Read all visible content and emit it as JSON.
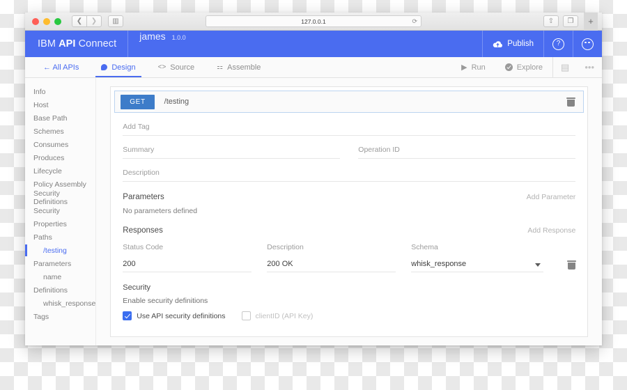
{
  "browser": {
    "url": "127.0.0.1",
    "back_icon": "chevron-left-icon",
    "forward_icon": "chevron-right-icon",
    "sidebar_icon": "sidebar-toggle-icon",
    "reload_icon": "reload-icon",
    "share_icon": "share-icon",
    "tabs_icon": "show-tabs-icon",
    "new_tab_label": "+"
  },
  "header": {
    "brand_prefix": "IBM",
    "brand_bold": "API",
    "brand_suffix": "Connect",
    "api_name": "james",
    "api_version": "1.0.0",
    "publish_label": "Publish",
    "publish_icon": "cloud-upload-icon",
    "help_icon": "question-mark-icon",
    "help_glyph": "?",
    "avatar_icon": "user-avatar-icon",
    "accent_color": "#4a6cf0"
  },
  "toolbar": {
    "all_apis_label": "← All APIs",
    "tabs": [
      {
        "label": "Design",
        "icon": "palette-icon",
        "active": true
      },
      {
        "label": "Source",
        "icon": "code-brackets-icon",
        "icon_glyph": "<>",
        "active": false
      },
      {
        "label": "Assemble",
        "icon": "assemble-icon",
        "icon_glyph": "⚏",
        "active": false
      }
    ],
    "run_label": "Run",
    "run_icon": "play-icon",
    "run_glyph": "▶",
    "explore_label": "Explore",
    "explore_icon": "explore-check-icon",
    "save_icon": "save-disk-icon",
    "save_glyph": "▤",
    "overflow_icon": "more-options-icon",
    "overflow_glyph": "•••"
  },
  "sidebar": {
    "items": [
      {
        "label": "Info",
        "level": 0,
        "active": false
      },
      {
        "label": "Host",
        "level": 0,
        "active": false
      },
      {
        "label": "Base Path",
        "level": 0,
        "active": false
      },
      {
        "label": "Schemes",
        "level": 0,
        "active": false
      },
      {
        "label": "Consumes",
        "level": 0,
        "active": false
      },
      {
        "label": "Produces",
        "level": 0,
        "active": false
      },
      {
        "label": "Lifecycle",
        "level": 0,
        "active": false
      },
      {
        "label": "Policy Assembly",
        "level": 0,
        "active": false
      },
      {
        "label": "Security Definitions",
        "level": 0,
        "active": false
      },
      {
        "label": "Security",
        "level": 0,
        "active": false
      },
      {
        "label": "Properties",
        "level": 0,
        "active": false
      },
      {
        "label": "Paths",
        "level": 0,
        "active": false
      },
      {
        "label": "/testing",
        "level": 1,
        "active": true
      },
      {
        "label": "Parameters",
        "level": 0,
        "active": false
      },
      {
        "label": "name",
        "level": 1,
        "active": false
      },
      {
        "label": "Definitions",
        "level": 0,
        "active": false
      },
      {
        "label": "whisk_response",
        "level": 1,
        "active": false
      },
      {
        "label": "Tags",
        "level": 0,
        "active": false
      }
    ]
  },
  "operation": {
    "method": "GET",
    "path": "/testing",
    "delete_icon": "trash-icon",
    "tag_placeholder": "Add Tag",
    "tag_value": "",
    "summary_placeholder": "Summary",
    "summary_value": "",
    "operation_id_placeholder": "Operation ID",
    "operation_id_value": "",
    "description_placeholder": "Description",
    "description_value": ""
  },
  "parameters": {
    "title": "Parameters",
    "add_label": "Add Parameter",
    "empty_text": "No parameters defined"
  },
  "responses": {
    "title": "Responses",
    "add_label": "Add Response",
    "columns": [
      "Status Code",
      "Description",
      "Schema"
    ],
    "rows": [
      {
        "status_code": "200",
        "description": "200 OK",
        "schema": "whisk_response",
        "delete_icon": "trash-icon",
        "dropdown_icon": "chevron-down-icon"
      }
    ]
  },
  "security": {
    "title": "Security",
    "subtitle": "Enable security definitions",
    "options": [
      {
        "label": "Use API security definitions",
        "checked": true,
        "disabled": false
      },
      {
        "label": "clientID (API Key)",
        "checked": false,
        "disabled": true
      }
    ]
  }
}
